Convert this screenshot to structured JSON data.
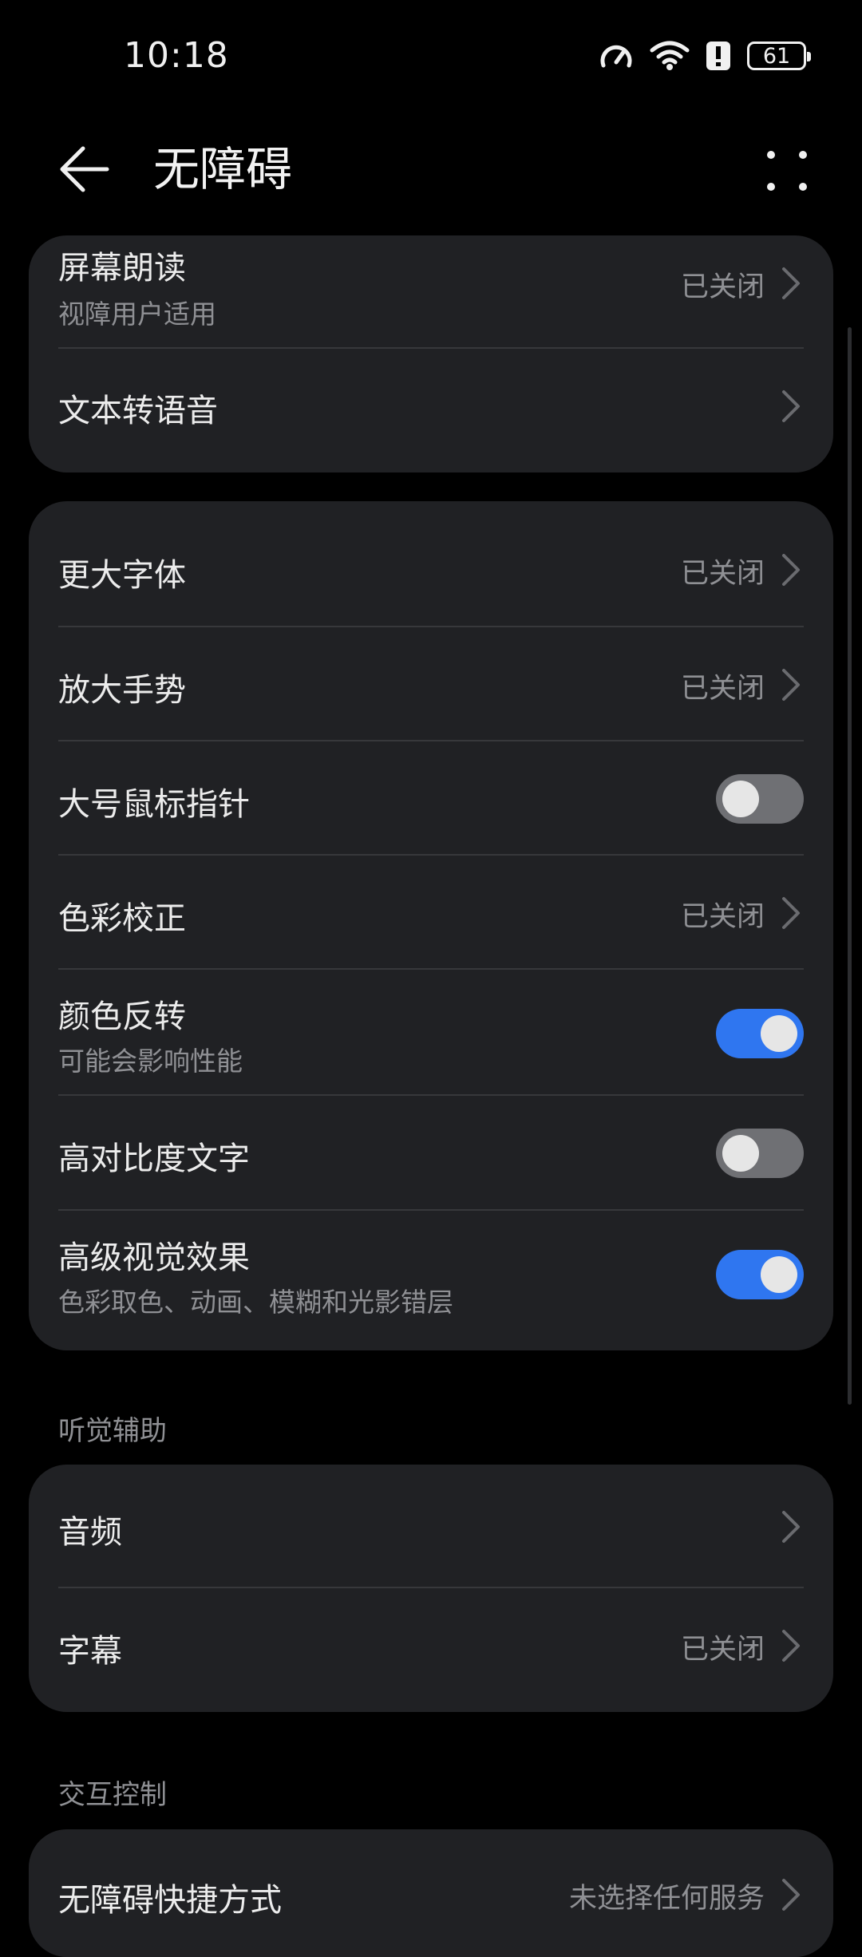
{
  "status_bar": {
    "time": "10:18",
    "battery": "61"
  },
  "header": {
    "title": "无障碍"
  },
  "vision_group": {
    "items": [
      {
        "title": "屏幕朗读",
        "subtitle": "视障用户适用",
        "value": "已关闭"
      },
      {
        "title": "文本转语音"
      }
    ]
  },
  "display_group": {
    "items": [
      {
        "title": "更大字体",
        "value": "已关闭"
      },
      {
        "title": "放大手势",
        "value": "已关闭"
      },
      {
        "title": "大号鼠标指针",
        "toggle": false
      },
      {
        "title": "色彩校正",
        "value": "已关闭"
      },
      {
        "title": "颜色反转",
        "subtitle": "可能会影响性能",
        "toggle": true
      },
      {
        "title": "高对比度文字",
        "toggle": false
      },
      {
        "title": "高级视觉效果",
        "subtitle": "色彩取色、动画、模糊和光影错层",
        "toggle": true
      }
    ]
  },
  "hearing": {
    "section_label": "听觉辅助",
    "items": [
      {
        "title": "音频"
      },
      {
        "title": "字幕",
        "value": "已关闭"
      }
    ]
  },
  "interaction": {
    "section_label": "交互控制",
    "items": [
      {
        "title": "无障碍快捷方式",
        "value": "未选择任何服务"
      }
    ]
  },
  "colors": {
    "accent": "#2f76f0",
    "card": "#202124",
    "background": "#000000"
  }
}
